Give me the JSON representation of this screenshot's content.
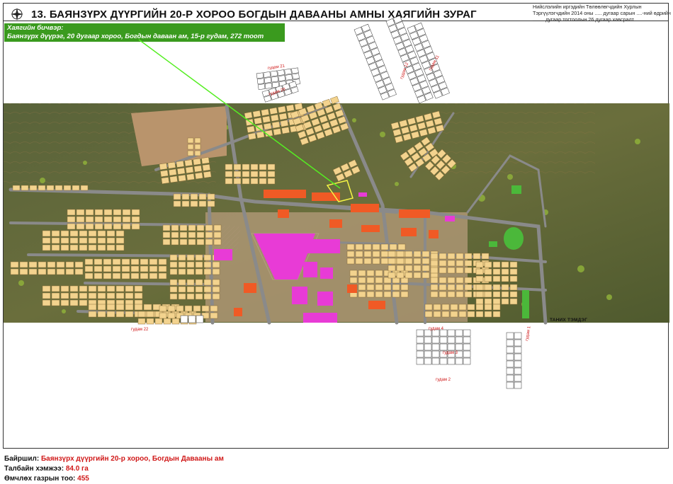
{
  "header": {
    "title": "13. БАЯНЗҮРХ ДҮҮРГИЙН 20-Р ХОРОО БОГДЫН ДАВААНЫ АМНЫ ХАЯГИЙН ЗУРАГ",
    "approval_lines": [
      "Нийслэлийн иргэдийн Төлөөлөгчдийн Хурлын",
      "Тэргүүлэгчдийн 2014 оны ..... дугаар сарын ....-ний өдрийн",
      "........ дугаар тогтоолын 26 дугаар хавсралт"
    ]
  },
  "address_box": {
    "heading": "Хаягийн бичвэр:",
    "text": "Баянзүрх дүүрэг, 20 дугаар хороо, Богдын даваан ам, 15-р гудам, 272 тоот"
  },
  "map": {
    "street_labels": [
      "гудам 21",
      "гудам 20",
      "гудам 11",
      "гудам 12",
      "гудам 22",
      "гудам 4",
      "гудам 3",
      "гудам 2",
      "гудам 1"
    ],
    "known_label": "ТАНИХ ТЭМДЭГ",
    "colors": {
      "terrain": "#5e6a3a",
      "road": "#7a7a7a",
      "plot": "#f3d38e",
      "zone": "#c9b48a",
      "public": "#e83bd6",
      "commercial": "#f05a25",
      "green": "#4bb83a"
    }
  },
  "info": {
    "location_label": "Байршил:",
    "location_value": "Баянзүрх дүүргийн 20-р хороо, Богдын Давааны ам",
    "area_label": "Талбайн хэмжээ:",
    "area_value": "84.0 га",
    "count_label": "Өмчлөх газрын тоо:",
    "count_value": "455"
  }
}
